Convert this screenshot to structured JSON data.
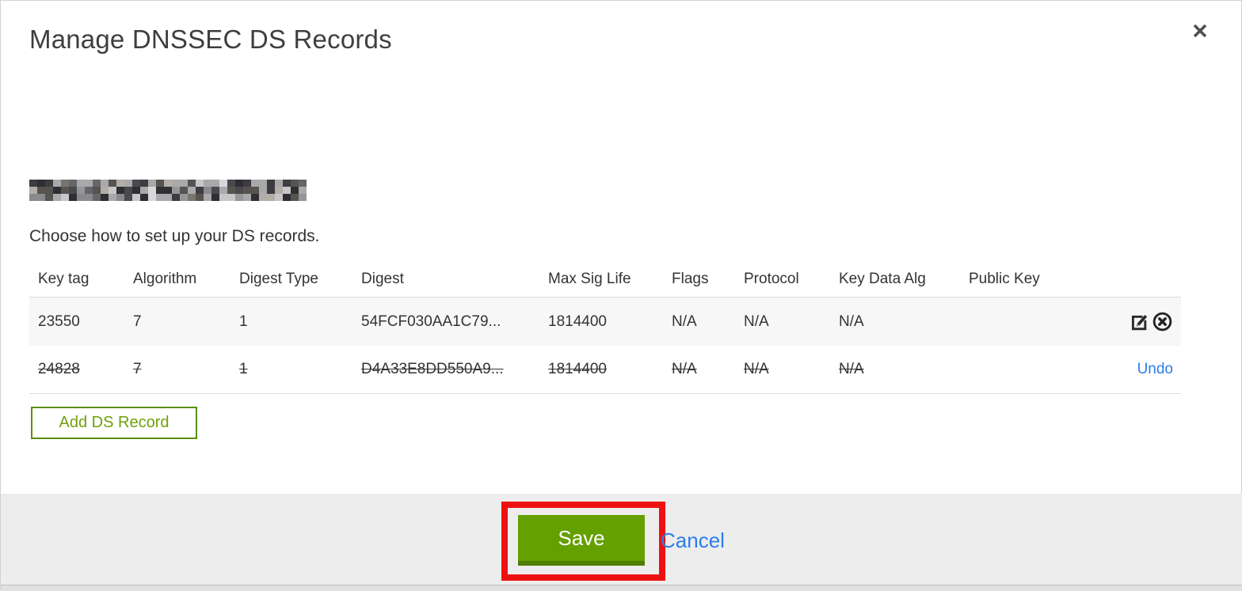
{
  "modal": {
    "title": "Manage DNSSEC DS Records"
  },
  "icons": {
    "close": "close-icon",
    "edit": "edit-icon",
    "delete": "delete-circle-icon"
  },
  "redacted_domain": {
    "note": "domain name pixelated/redacted",
    "palette": [
      "#2f2f33",
      "#4a4a4e",
      "#66666a",
      "#8a8a8e",
      "#a9a9ac",
      "#c7c7c9",
      "#57534e",
      "#7a766f",
      "#b3aea6",
      "#3d3d41",
      "#96969a",
      "#d8d8da"
    ]
  },
  "instruction": "Choose how to set up your DS records.",
  "table": {
    "columns": [
      "Key tag",
      "Algorithm",
      "Digest Type",
      "Digest",
      "Max Sig Life",
      "Flags",
      "Protocol",
      "Key Data Alg",
      "Public Key"
    ],
    "rows": [
      {
        "state": "active",
        "cells": [
          "23550",
          "7",
          "1",
          "54FCF030AA1C79...",
          "1814400",
          "N/A",
          "N/A",
          "N/A",
          ""
        ]
      },
      {
        "state": "deleted",
        "cells": [
          "24828",
          "7",
          "1",
          "D4A33E8DD550A9...",
          "1814400",
          "N/A",
          "N/A",
          "N/A",
          ""
        ],
        "undo_label": "Undo"
      }
    ]
  },
  "buttons": {
    "add_ds_record": "Add DS Record",
    "save": "Save",
    "cancel": "Cancel"
  },
  "colors": {
    "save_green": "#63a000",
    "save_green_dark": "#4e7d00",
    "add_border_green": "#5a8f02",
    "link_blue": "#2e7de9",
    "annotation_red": "#ee1111",
    "footer_gray": "#ededed",
    "row_gray": "#f7f7f7"
  }
}
